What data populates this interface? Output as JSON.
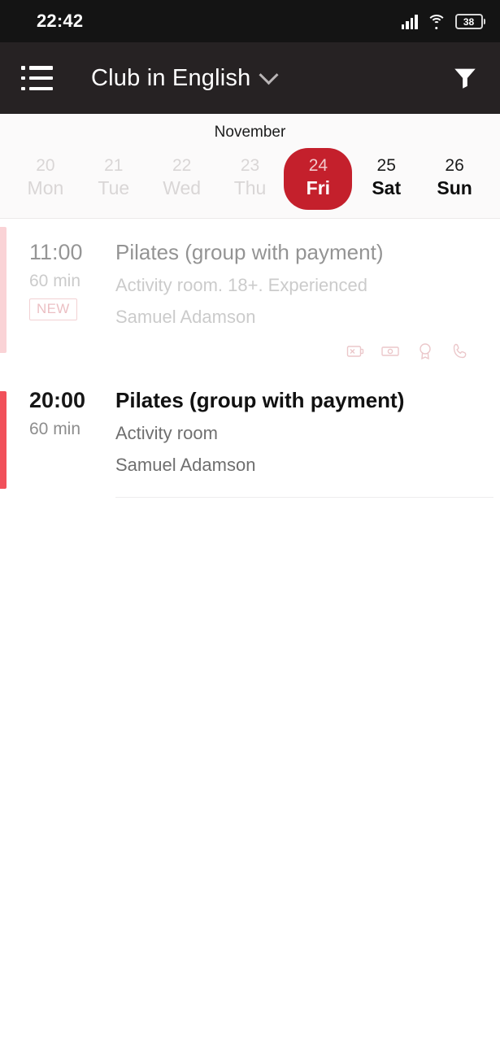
{
  "statusbar": {
    "clock": "22:42",
    "battery_percent": "38",
    "icons": [
      "signal-icon",
      "wifi-icon",
      "battery-icon"
    ]
  },
  "appbar": {
    "menu_icon": "list-menu-icon",
    "title": "Club in English",
    "dropdown_icon": "chevron-down-icon",
    "filter_icon": "filter-icon",
    "background": "#262223"
  },
  "datestrip": {
    "month": "November",
    "selected_color": "#c4202c",
    "days": [
      {
        "num": "20",
        "name": "Mon",
        "state": "past"
      },
      {
        "num": "21",
        "name": "Tue",
        "state": "past"
      },
      {
        "num": "22",
        "name": "Wed",
        "state": "past"
      },
      {
        "num": "23",
        "name": "Thu",
        "state": "past"
      },
      {
        "num": "24",
        "name": "Fri",
        "state": "selected"
      },
      {
        "num": "25",
        "name": "Sat",
        "state": "future"
      },
      {
        "num": "26",
        "name": "Sun",
        "state": "future"
      }
    ]
  },
  "events": [
    {
      "time": "11:00",
      "duration": "60 min",
      "badge": "NEW",
      "title": "Pilates (group with payment)",
      "subtitle": "Activity room. 18+. Experienced",
      "trainer": "Samuel Adamson",
      "accent_color": "#f4a0a6",
      "state": "past",
      "icons": [
        "card-declined-icon",
        "cash-payment-icon",
        "award-icon",
        "phone-icon"
      ]
    },
    {
      "time": "20:00",
      "duration": "60 min",
      "badge": "",
      "title": "Pilates (group with payment)",
      "subtitle": "Activity room",
      "trainer": "Samuel Adamson",
      "accent_color": "#f1505a",
      "state": "upcoming",
      "icons": []
    }
  ]
}
